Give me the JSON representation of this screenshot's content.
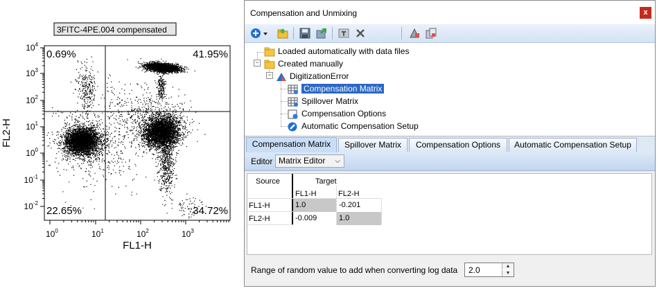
{
  "plot": {
    "sample_label": "3FITC-4PE.004 compensated",
    "quadrants": {
      "upper_left": "0.69%",
      "upper_right": "41.95%",
      "lower_left": "22.65%",
      "lower_right": "34.72%"
    },
    "x_axis": {
      "label": "FL1-H",
      "ticks": [
        {
          "base": "10",
          "exp": "0"
        },
        {
          "base": "10",
          "exp": "1"
        },
        {
          "base": "10",
          "exp": "2"
        },
        {
          "base": "10",
          "exp": "3"
        }
      ]
    },
    "y_axis": {
      "label": "FL2-H",
      "ticks": [
        {
          "base": "10",
          "exp": "4"
        },
        {
          "base": "10",
          "exp": "3"
        },
        {
          "base": "10",
          "exp": "2"
        },
        {
          "base": "10",
          "exp": "1"
        },
        {
          "base": "10",
          "exp": "0"
        },
        {
          "base": "10",
          "exp": "-1"
        },
        {
          "base": "10",
          "exp": "-2"
        }
      ]
    }
  },
  "dialog": {
    "title": "Compensation and Unmixing",
    "close_glyph": "x",
    "toolbar_icons": [
      "add-icon",
      "dropdown-arrow-icon",
      "open-folder-icon",
      "save-icon",
      "export-icon",
      "rename-icon",
      "delete-icon",
      "gate-icon",
      "copy-icon"
    ],
    "tree": {
      "loaded": "Loaded automatically with data files",
      "manual": "Created manually",
      "digitization": "DigitizationError",
      "comp_matrix": "Compensation Matrix",
      "spill_matrix": "Spillover Matrix",
      "comp_options": "Compensation Options",
      "auto_setup": "Automatic Compensation Setup"
    },
    "tabs": [
      "Compensation Matrix",
      "Spillover Matrix",
      "Compensation Options",
      "Automatic Compensation Setup"
    ],
    "editor": {
      "label": "Editor",
      "selected": "Matrix Editor"
    },
    "matrix": {
      "source_label": "Source",
      "target_label": "Target",
      "columns": [
        "FL1-H",
        "FL2-H"
      ],
      "rows": [
        {
          "name": "FL1-H",
          "values": [
            "1.0",
            "-0.201"
          ]
        },
        {
          "name": "FL2-H",
          "values": [
            "-0.009",
            "1.0"
          ]
        }
      ]
    },
    "random": {
      "label": "Range of random value to add when converting log data",
      "value": "2.0"
    }
  }
}
